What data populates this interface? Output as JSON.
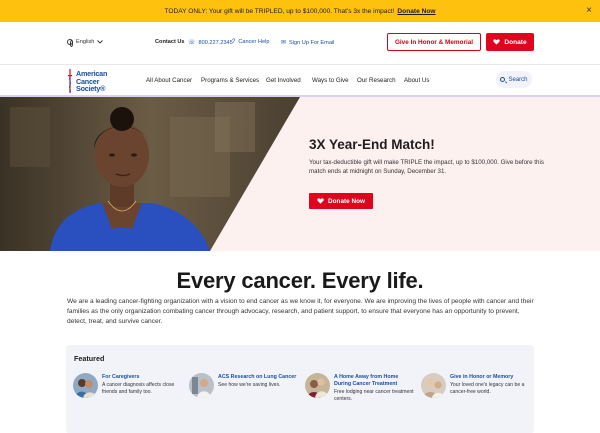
{
  "banner": {
    "text": "TODAY ONLY: Your gift will be TRIPLED, up to $100,000. That's 3x the impact!",
    "link": "Donate Now",
    "close": "×"
  },
  "utility": {
    "language": "English",
    "contact": "Contact Us",
    "phone": "800.227.2345",
    "help": "Cancer Help",
    "signup": "Sign Up For Email",
    "honor_button": "Give In Honor & Memorial",
    "donate_button": "Donate"
  },
  "nav": {
    "logo_lines": [
      "American",
      "Cancer",
      "Society®"
    ],
    "items": [
      "All About Cancer",
      "Programs & Services",
      "Get Involved",
      "Ways to Give",
      "Our Research",
      "About Us"
    ],
    "search": "Search"
  },
  "hero": {
    "title": "3X Year-End Match!",
    "body": "Your tax-deductible gift will make TRIPLE the impact, up to $100,000. Give before this match ends at midnight on Sunday, December 31.",
    "button": "Donate Now"
  },
  "tagline": "Every cancer. Every life.",
  "intro": "We are a leading cancer-fighting organization with a vision to end cancer as we know it, for everyone. We are improving the lives of people with cancer and their families as the only organization combating cancer through advocacy, research, and patient support, to ensure that everyone has an opportunity to prevent, detect, treat, and survive cancer.",
  "featured": {
    "heading": "Featured",
    "cards": [
      {
        "title": "For Caregivers",
        "desc": "A cancer diagnosis affects close friends and family too."
      },
      {
        "title": "ACS Research on Lung Cancer",
        "desc": "See how we're saving lives."
      },
      {
        "title": "A Home Away from Home During Cancer Treatment",
        "desc": "Free lodging near cancer treatment centers."
      },
      {
        "title": "Give in Honor or Memory",
        "desc": "Your loved one's legacy can be a cancer-free world."
      }
    ]
  },
  "colors": {
    "banner": "#fdc10e",
    "brand_red": "#e0041f",
    "brand_blue": "#1b4ea3",
    "hero_bg": "#fdf1f0",
    "featured_bg": "#f1f3f9"
  }
}
